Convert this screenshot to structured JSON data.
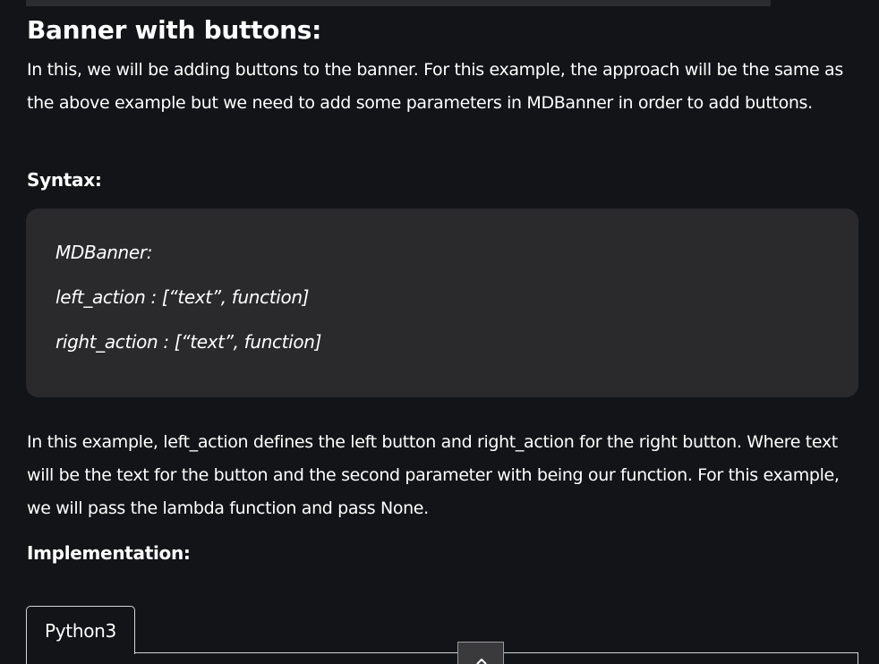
{
  "article": {
    "heading": "Banner with buttons:",
    "intro": "In this, we will be adding buttons to the banner. For this example, the approach will be the same as the above example but we need to add some parameters in MDBanner in order to add buttons.",
    "syntax_label": "Syntax:",
    "syntax_lines": [
      "MDBanner:",
      "left_action : [“text”, function]",
      "right_action : [“text”, function]"
    ],
    "explanation": "In this example, left_action defines the left button and right_action for the right button. Where text will be the text for the button and the second parameter with being our function. For this example, we will pass the lambda function and pass None.",
    "implementation_label": "Implementation:"
  },
  "code_block": {
    "tab_label": "Python3",
    "scroll_icon": "chevron-up-icon"
  },
  "colors": {
    "background": "#131417",
    "syntax_box": "#2a2a2d",
    "text": "#ffffff",
    "border": "#d6d6d6"
  }
}
